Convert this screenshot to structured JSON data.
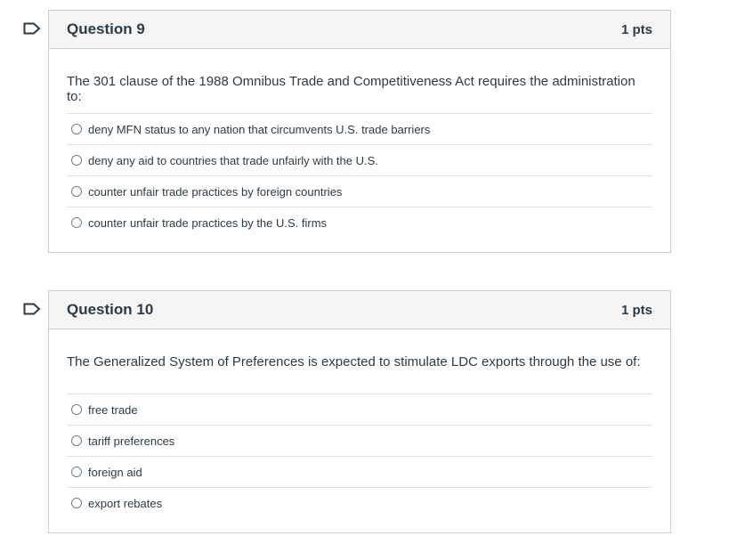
{
  "questions": [
    {
      "title": "Question 9",
      "points": "1 pts",
      "text": "The 301 clause of the 1988 Omnibus Trade and Competitiveness Act requires the administration to:",
      "answers": [
        "deny MFN status to any nation that circumvents U.S. trade barriers",
        "deny any aid to countries that trade unfairly with the U.S.",
        "counter unfair trade practices by foreign countries",
        "counter unfair trade practices by the U.S. firms"
      ]
    },
    {
      "title": "Question 10",
      "points": "1 pts",
      "text": "The Generalized System of Preferences is expected to stimulate LDC exports through the use of:",
      "answers": [
        "free trade",
        "tariff preferences",
        "foreign aid",
        "export rebates"
      ]
    }
  ],
  "icons": {
    "flag": "flag-icon",
    "radio": "radio-button-icon"
  }
}
